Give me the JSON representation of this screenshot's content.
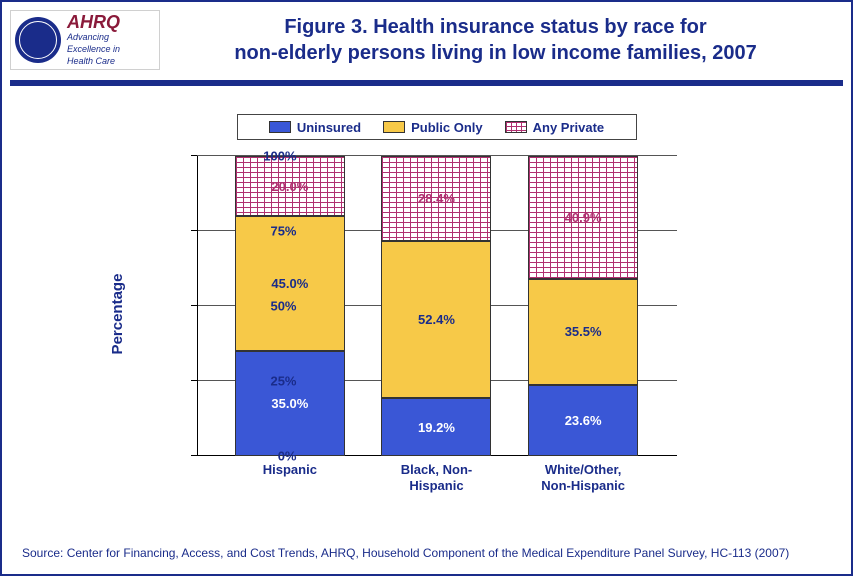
{
  "header": {
    "logo_brand": "AHRQ",
    "logo_tag1": "Advancing",
    "logo_tag2": "Excellence in",
    "logo_tag3": "Health Care"
  },
  "title_line1": "Figure 3. Health insurance status by race for",
  "title_line2": "non-elderly persons living in low income families, 2007",
  "legend": {
    "uninsured": "Uninsured",
    "public": "Public Only",
    "private": "Any Private"
  },
  "yaxis_label": "Percentage",
  "yticks": {
    "t0": "0%",
    "t25": "25%",
    "t50": "50%",
    "t75": "75%",
    "t100": "100%"
  },
  "categories": {
    "c0": "Hispanic",
    "c1": "Black, Non-\nHispanic",
    "c2": "White/Other,\nNon-Hispanic"
  },
  "values": {
    "c0": {
      "uninsured": "35.0%",
      "public": "45.0%",
      "private": "20.0%"
    },
    "c1": {
      "uninsured": "19.2%",
      "public": "52.4%",
      "private": "28.4%"
    },
    "c2": {
      "uninsured": "23.6%",
      "public": "35.5%",
      "private": "40.9%"
    }
  },
  "source": "Source: Center for Financing, Access, and Cost Trends, AHRQ, Household Component of the Medical Expenditure Panel Survey, HC-113 (2007)",
  "chart_data": {
    "type": "bar",
    "stacked": true,
    "title": "Figure 3. Health insurance status by race for non-elderly persons living in low income families, 2007",
    "ylabel": "Percentage",
    "xlabel": "",
    "ylim": [
      0,
      100
    ],
    "categories": [
      "Hispanic",
      "Black, Non-Hispanic",
      "White/Other, Non-Hispanic"
    ],
    "series": [
      {
        "name": "Uninsured",
        "values": [
          35.0,
          19.2,
          23.6
        ],
        "color": "#3a57d6"
      },
      {
        "name": "Public Only",
        "values": [
          45.0,
          52.4,
          35.5
        ],
        "color": "#f7c948"
      },
      {
        "name": "Any Private",
        "values": [
          20.0,
          28.4,
          40.9
        ],
        "color": "#b03070",
        "pattern": "brick"
      }
    ]
  }
}
